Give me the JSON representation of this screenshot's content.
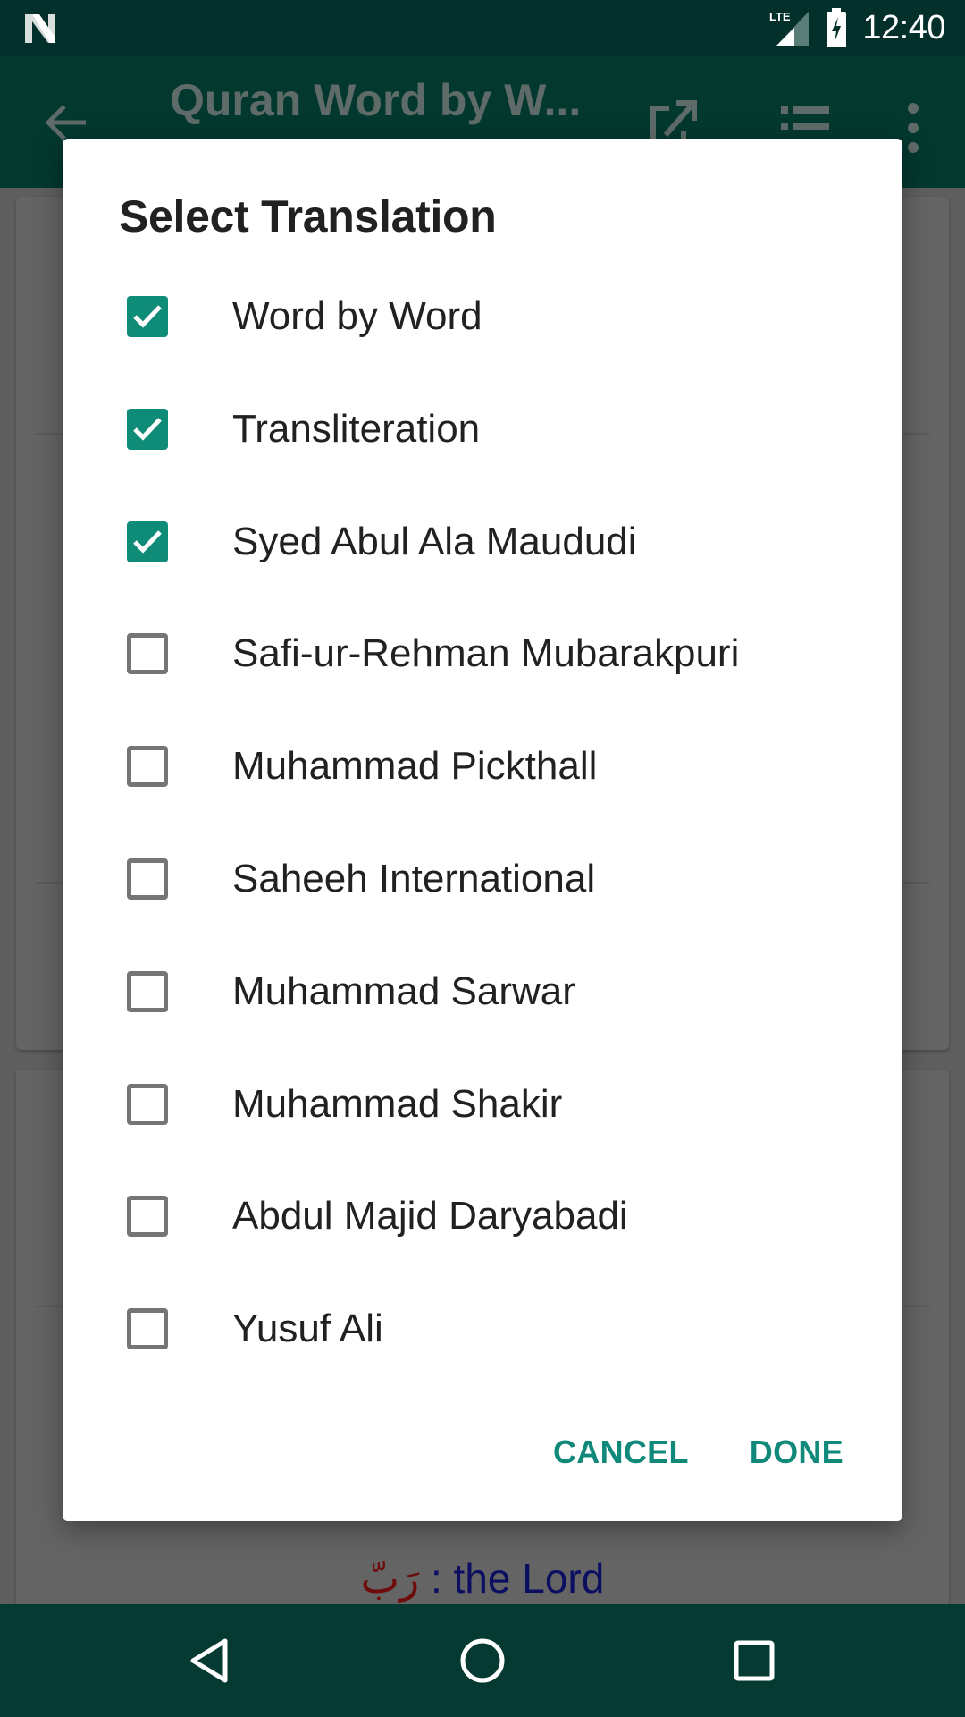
{
  "status_bar": {
    "network": "LTE",
    "time": "12:40",
    "icons": [
      "notification-n-icon",
      "lte-signal-icon",
      "battery-charging-icon"
    ]
  },
  "app_bar": {
    "title": "Quran Word by W...",
    "icons": [
      "back-arrow-icon",
      "share-icon",
      "list-icon",
      "more-vert-icon"
    ]
  },
  "background": {
    "word_arabic": "رَبّ",
    "word_separator": " : ",
    "word_meaning": "the Lord"
  },
  "dialog": {
    "title": "Select Translation",
    "options": [
      {
        "label": "Word by Word",
        "checked": true
      },
      {
        "label": "Transliteration",
        "checked": true
      },
      {
        "label": "Syed Abul Ala Maududi",
        "checked": true
      },
      {
        "label": "Safi-ur-Rehman Mubarakpuri",
        "checked": false
      },
      {
        "label": "Muhammad Pickthall",
        "checked": false
      },
      {
        "label": "Saheeh International",
        "checked": false
      },
      {
        "label": "Muhammad Sarwar",
        "checked": false
      },
      {
        "label": "Muhammad Shakir",
        "checked": false
      },
      {
        "label": "Abdul Majid Daryabadi",
        "checked": false
      },
      {
        "label": "Yusuf Ali",
        "checked": false
      }
    ],
    "cancel_label": "CANCEL",
    "done_label": "DONE"
  },
  "colors": {
    "accent": "#0f8c78",
    "status_bar": "#03302a",
    "nav_bar": "#043a31"
  },
  "nav_bar": {
    "icons": [
      "back-triangle-icon",
      "home-circle-icon",
      "recents-square-icon"
    ]
  }
}
